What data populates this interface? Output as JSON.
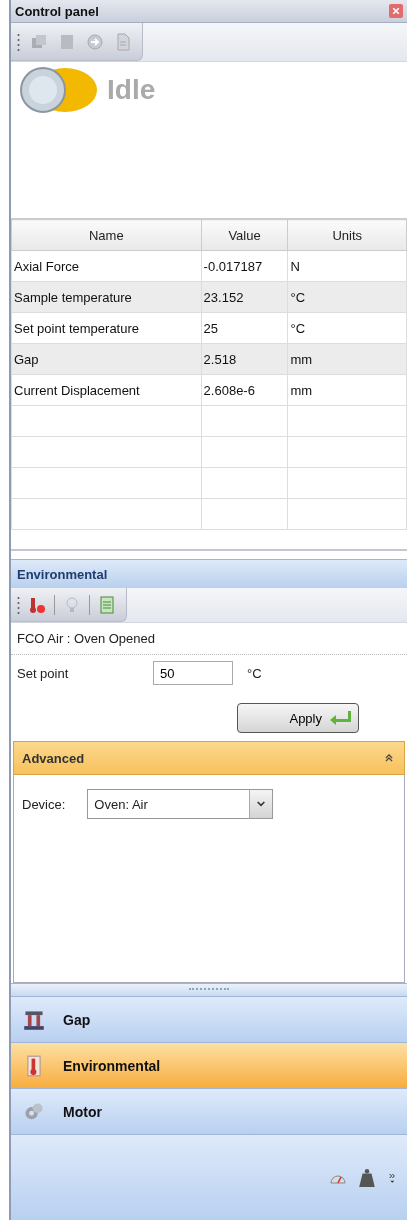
{
  "window": {
    "title": "Control panel"
  },
  "status": {
    "label": "Idle"
  },
  "table": {
    "columns": [
      "Name",
      "Value",
      "Units"
    ],
    "rows": [
      [
        "Axial Force",
        "-0.017187",
        "N"
      ],
      [
        "Sample temperature",
        "23.152",
        "°C"
      ],
      [
        "Set point temperature",
        "25",
        "°C"
      ],
      [
        "Gap",
        "2.518",
        "mm"
      ],
      [
        "Current Displacement",
        "2.608e-6",
        "mm"
      ]
    ]
  },
  "environmental": {
    "title": "Environmental",
    "status_text": "FCO Air : Oven Opened",
    "setpoint_label": "Set point",
    "setpoint_value": "50",
    "setpoint_unit": "°C",
    "apply_label": "Apply"
  },
  "advanced": {
    "title": "Advanced",
    "expanded": true,
    "device_label": "Device:",
    "device_value": "Oven: Air"
  },
  "nav_items": [
    {
      "label": "Gap",
      "selected": false
    },
    {
      "label": "Environmental",
      "selected": true
    },
    {
      "label": "Motor",
      "selected": false
    }
  ]
}
